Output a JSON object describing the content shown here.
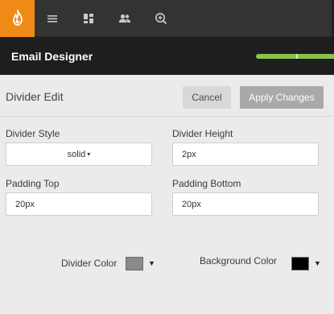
{
  "app": {
    "title": "Email Designer",
    "brand_color": "#ef8a17",
    "nav_icons": [
      "flame-logo-icon",
      "menu-lines-icon",
      "dashboard-grid-icon",
      "people-icon",
      "add-search-icon"
    ]
  },
  "editor": {
    "title": "Divider Edit",
    "cancel_label": "Cancel",
    "apply_label": "Apply Changes",
    "divider_style": {
      "label": "Divider Style",
      "value": "solid",
      "caret": "▾"
    },
    "divider_height": {
      "label": "Divider Height",
      "value": "2px"
    },
    "padding_top": {
      "label": "Padding Top",
      "value": "20px"
    },
    "padding_bottom": {
      "label": "Padding Bottom",
      "value": "20px"
    },
    "divider_color": {
      "label": "Divider Color",
      "value": "#8a8a8a",
      "caret": "▼"
    },
    "background_color": {
      "label": "Background Color",
      "value": "#000000",
      "caret": "▼"
    }
  }
}
